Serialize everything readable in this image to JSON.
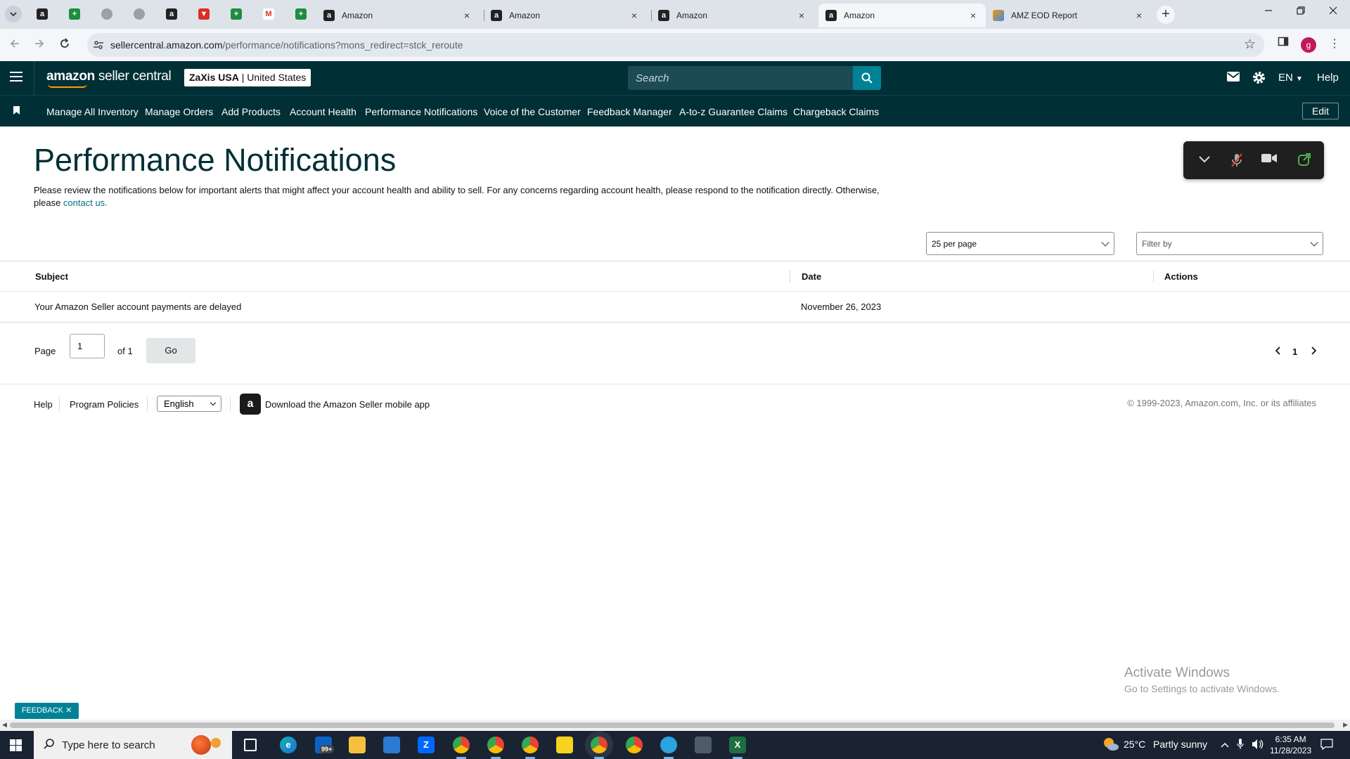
{
  "browser": {
    "tabs": [
      {
        "label": "Amazon"
      },
      {
        "label": "Amazon"
      },
      {
        "label": "Amazon"
      },
      {
        "label": "Amazon"
      },
      {
        "label": "AMZ EOD Report"
      }
    ],
    "close_glyph": "×",
    "new_tab_glyph": "+",
    "url_host": "sellercentral.amazon.com",
    "url_path": "/performance/notifications?mons_redirect=stck_reroute",
    "profile_initial": "g"
  },
  "topbar": {
    "logo_brand": "amazon",
    "logo_rest": " seller central",
    "account_name": "ZaXis USA",
    "account_region": " | United States",
    "search_placeholder": "Search",
    "language": "EN",
    "help": "Help"
  },
  "nav": {
    "items": [
      "Manage All Inventory",
      "Manage Orders",
      "Add Products",
      "Account Health",
      "Performance Notifications",
      "Voice of the Customer",
      "Feedback Manager",
      "A-to-z Guarantee Claims",
      "Chargeback Claims"
    ],
    "edit_label": "Edit"
  },
  "page": {
    "title": "Performance Notifications",
    "intro_text": "Please review the notifications below for important alerts that might affect your account health and ability to sell. For any concerns regarding account health, please respond to the notification directly. Otherwise, please ",
    "contact_link": "contact us.",
    "per_page": "25 per page",
    "filter_placeholder": "Filter by"
  },
  "table": {
    "headers": [
      "Subject",
      "Date",
      "Actions"
    ],
    "rows": [
      {
        "subject": "Your Amazon Seller account payments are delayed",
        "date": "November 26, 2023",
        "actions": ""
      }
    ]
  },
  "pagination": {
    "page_label": "Page",
    "current_page": "1",
    "of_label": "of 1",
    "go_label": "Go",
    "page_number": "1"
  },
  "footer": {
    "help": "Help",
    "program_policies": "Program Policies",
    "language": "English",
    "download_app": "Download the Amazon Seller mobile app",
    "copyright": "© 1999-2023, Amazon.com, Inc. or its affiliates"
  },
  "overlay": {
    "activate_title": "Activate Windows",
    "activate_sub": "Go to Settings to activate Windows.",
    "feedback_label": "FEEDBACK"
  },
  "taskbar": {
    "search_placeholder": "Type here to search",
    "mail_badge": "99+",
    "weather_temp": "25°C",
    "weather_desc": "Partly sunny",
    "time": "6:35 AM",
    "date": "11/28/2023"
  },
  "colors": {
    "seller_central_bar": "#002f36",
    "search_button": "#008296",
    "link": "#007185",
    "logo_smile": "#ff9900"
  }
}
